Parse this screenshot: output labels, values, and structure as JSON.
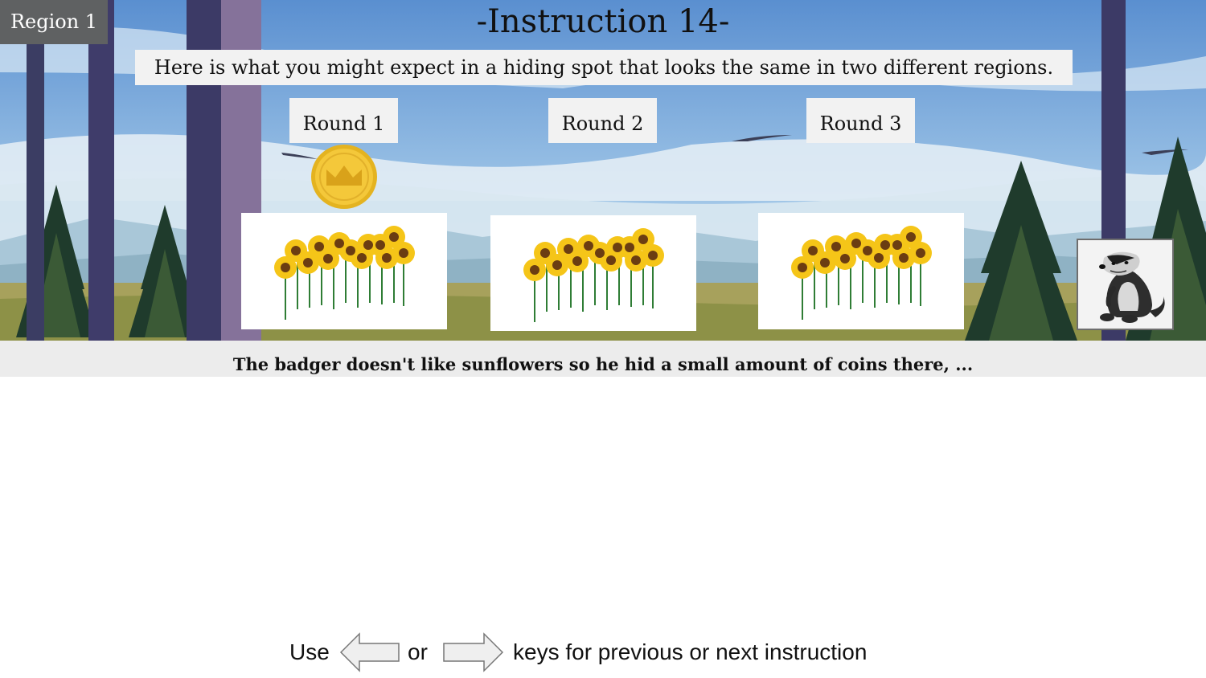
{
  "region_badge": "Region 1",
  "title": "-Instruction 14-",
  "subtitle": "Here is what you might expect in a hiding spot that looks the same in two different regions.",
  "rounds": [
    {
      "label": "Round 1",
      "has_coin": true
    },
    {
      "label": "Round 2",
      "has_coin": false
    },
    {
      "label": "Round 3",
      "has_coin": false
    }
  ],
  "caption": "The badger doesn't like sunflowers so he hid a small amount of coins there, ...",
  "navigation": {
    "use": "Use",
    "or": "or",
    "rest": "keys for previous or next instruction"
  },
  "icons": {
    "coin": "coin-crown-icon",
    "badger": "badger-icon",
    "left_arrow": "left-arrow-key-icon",
    "right_arrow": "right-arrow-key-icon",
    "sunflowers": "sunflower-patch-icon"
  },
  "colors": {
    "sky": "#6f9fd6",
    "coin": "#f2c52a",
    "badge": "#5f6162",
    "caption_bar": "#ececec"
  }
}
